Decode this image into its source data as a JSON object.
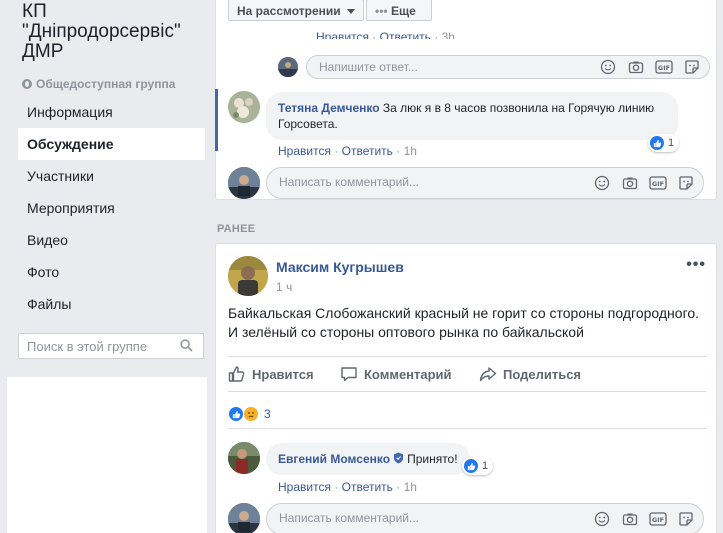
{
  "group": {
    "title_lines": [
      "КП",
      "\"Дніпродорсервіс\"",
      "ДМР"
    ],
    "type": "Общедоступная группа"
  },
  "nav": {
    "items": [
      {
        "label": "Информация"
      },
      {
        "label": "Обсуждение"
      },
      {
        "label": "Участники"
      },
      {
        "label": "Мероприятия"
      },
      {
        "label": "Видео"
      },
      {
        "label": "Фото"
      },
      {
        "label": "Файлы"
      }
    ],
    "active": "Обсуждение"
  },
  "search": {
    "placeholder": "Поиск в этой группе"
  },
  "filters": {
    "review_label": "На рассмотрении",
    "more_label": "Еще"
  },
  "top_thread": {
    "partial_meta": {
      "like": "Нравится",
      "sep1": " · ",
      "reply": "Ответить",
      "sep2": " · ",
      "time": "3h"
    },
    "reply_input_placeholder": "Напишите ответ...",
    "comment": {
      "author": "Тетяна Демченко",
      "text": "За люк я в 8 часов позвонила на Горячую линию Горсовета.",
      "like": "Нравится",
      "reply": "Ответить",
      "time": "1h",
      "reaction_count": "1"
    },
    "comment_input_placeholder": "Написать комментарий..."
  },
  "section_label": "РАНЕЕ",
  "post": {
    "author": "Максим Кугрышев",
    "time": "1 ч",
    "dots": "•••",
    "text_line1": "Байкальская Слобожанский красный не горит со стороны подгородного.",
    "text_line2": "И зелёный со стороны оптового рынка по байкальской",
    "actions": {
      "like": "Нравится",
      "comment": "Комментарий",
      "share": "Поделиться"
    },
    "reactions_count": "3",
    "comment": {
      "author": "Евгений Момсенко",
      "text": "Принято!",
      "like": "Нравится",
      "reply": "Ответить",
      "time": "1h",
      "reaction_count": "1"
    },
    "comment_input_placeholder": "Написать комментарий..."
  },
  "colors": {
    "link": "#385898",
    "like_blue": "#2078f4",
    "background": "#e9ebee",
    "muted": "#90949c"
  },
  "icons": [
    "globe-icon",
    "search-icon",
    "emoji-icon",
    "camera-icon",
    "gif-icon",
    "sticker-icon",
    "like-icon",
    "comment-icon",
    "share-icon",
    "sad-icon",
    "admin-shield-icon",
    "more-icon"
  ]
}
